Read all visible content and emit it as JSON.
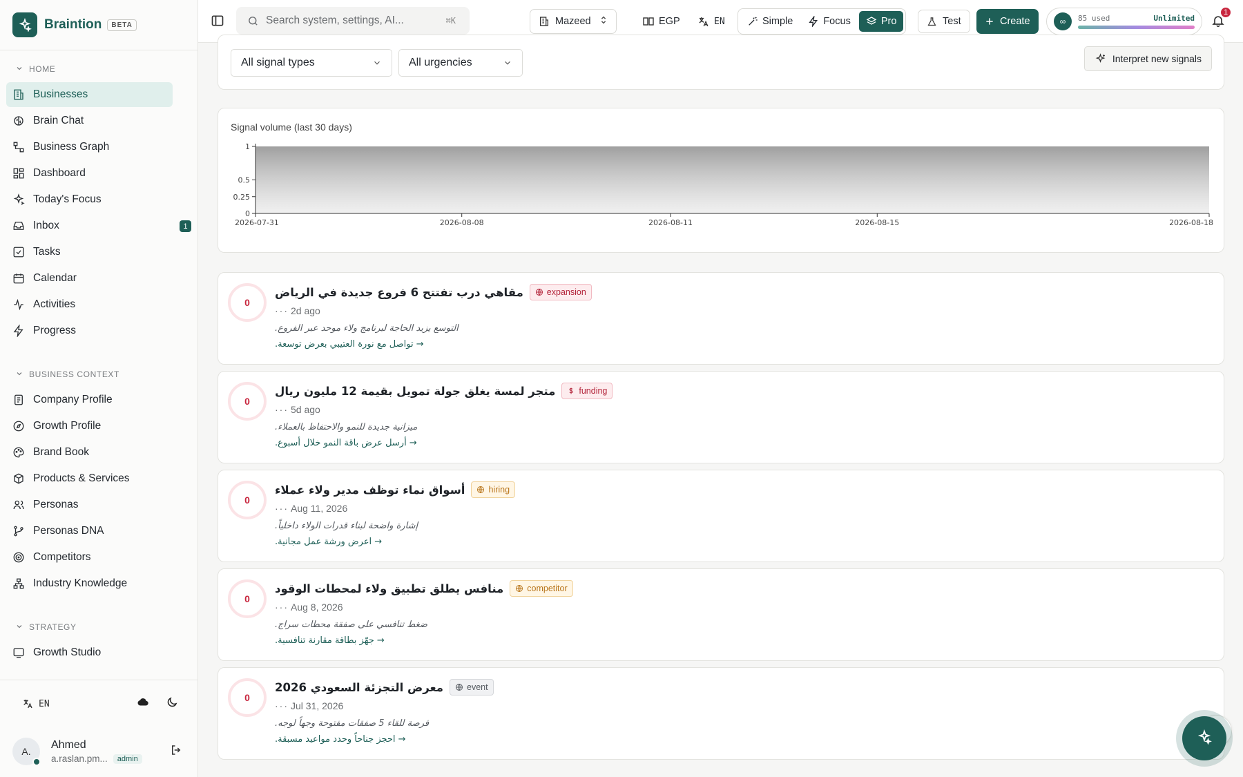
{
  "brand": {
    "name": "Braintion",
    "badge": "BETA"
  },
  "sidebar": {
    "sections": [
      {
        "title": "HOME",
        "items": [
          {
            "label": "Businesses",
            "icon": "building-icon",
            "active": true
          },
          {
            "label": "Brain Chat",
            "icon": "brain-icon"
          },
          {
            "label": "Business Graph",
            "icon": "graph-icon"
          },
          {
            "label": "Dashboard",
            "icon": "dashboard-icon"
          },
          {
            "label": "Today's Focus",
            "icon": "sparkle-icon"
          },
          {
            "label": "Inbox",
            "icon": "inbox-icon",
            "badge": "1"
          },
          {
            "label": "Tasks",
            "icon": "checkbox-icon"
          },
          {
            "label": "Calendar",
            "icon": "calendar-icon"
          },
          {
            "label": "Activities",
            "icon": "pulse-icon"
          },
          {
            "label": "Progress",
            "icon": "bolt-icon"
          }
        ]
      },
      {
        "title": "BUSINESS CONTEXT",
        "items": [
          {
            "label": "Company Profile",
            "icon": "document-icon"
          },
          {
            "label": "Growth Profile",
            "icon": "compass-icon"
          },
          {
            "label": "Brand Book",
            "icon": "palette-icon"
          },
          {
            "label": "Products & Services",
            "icon": "box-icon"
          },
          {
            "label": "Personas",
            "icon": "users-icon"
          },
          {
            "label": "Personas DNA",
            "icon": "branch-icon"
          },
          {
            "label": "Competitors",
            "icon": "target-icon"
          },
          {
            "label": "Industry Knowledge",
            "icon": "sitemap-icon"
          }
        ]
      },
      {
        "title": "STRATEGY",
        "items": [
          {
            "label": "Growth Studio",
            "icon": "studio-icon"
          }
        ]
      }
    ],
    "footer": {
      "lang": "EN",
      "user_name": "Ahmed",
      "user_email": "a.raslan.pm...",
      "role": "admin",
      "avatar_initials": "A."
    }
  },
  "topbar": {
    "search_placeholder": "Search system, settings, AI...",
    "search_shortcut": "⌘K",
    "business": "Mazeed",
    "currency": "EGP",
    "language": "EN",
    "modes": [
      "Simple",
      "Focus",
      "Pro"
    ],
    "active_mode": "Pro",
    "test_label": "Test",
    "create_label": "Create",
    "usage_used": "85 used",
    "usage_limit": "Unlimited",
    "usage_icon": "∞",
    "notifications": "1"
  },
  "filters": {
    "signal_type": "All signal types",
    "urgency": "All urgencies",
    "interpret_label": "Interpret new signals"
  },
  "chart_data": {
    "type": "area",
    "title": "Signal volume (last 30 days)",
    "x_ticks": [
      "2026-07-31",
      "2026-08-08",
      "2026-08-11",
      "2026-08-15",
      "2026-08-18"
    ],
    "y_ticks": [
      "1",
      "0.5",
      "0.25",
      "0"
    ],
    "x": [
      "2026-07-31",
      "2026-08-18"
    ],
    "values": [
      1,
      1
    ],
    "ylim": [
      0,
      1
    ]
  },
  "signals": [
    {
      "score": "0",
      "title": "مقاهي درب تفتتح 6 فروع جديدة في الرياض",
      "tag": "expansion",
      "tag_style": "pink",
      "tag_icon": "globe-icon",
      "time": "2d ago",
      "reason": "التوسع يزيد الحاجة لبرنامج ولاء موحد عبر الفروع.",
      "action": "→ تواصل مع نورة العتيبي بعرض توسعة."
    },
    {
      "score": "0",
      "title": "متجر لمسة يغلق جولة تمويل بقيمة 12 مليون ريال",
      "tag": "funding",
      "tag_style": "pink",
      "tag_icon": "dollar-icon",
      "time": "5d ago",
      "reason": "ميزانية جديدة للنمو والاحتفاظ بالعملاء.",
      "action": "→ أرسل عرض باقة النمو خلال أسبوع."
    },
    {
      "score": "0",
      "title": "أسواق نماء توظف مدير ولاء عملاء",
      "tag": "hiring",
      "tag_style": "amber",
      "tag_icon": "globe-icon",
      "time": "Aug 11, 2026",
      "reason": "إشارة واضحة لبناء قدرات الولاء داخلياً.",
      "action": "→ اعرض ورشة عمل مجانية."
    },
    {
      "score": "0",
      "title": "منافس يطلق تطبيق ولاء لمحطات الوقود",
      "tag": "competitor",
      "tag_style": "amber",
      "tag_icon": "globe-icon",
      "time": "Aug 8, 2026",
      "reason": "ضغط تنافسي على صفقة محطات سراج.",
      "action": "→ جهّز بطاقة مقارنة تنافسية."
    },
    {
      "score": "0",
      "title": "معرض التجزئة السعودي 2026",
      "tag": "event",
      "tag_style": "gray",
      "tag_icon": "globe-icon",
      "time": "Jul 31, 2026",
      "reason": "فرصة للقاء 5 صفقات مفتوحة وجهاً لوجه.",
      "action": "→ احجز جناحاً وحدد مواعيد مسبقة."
    }
  ]
}
